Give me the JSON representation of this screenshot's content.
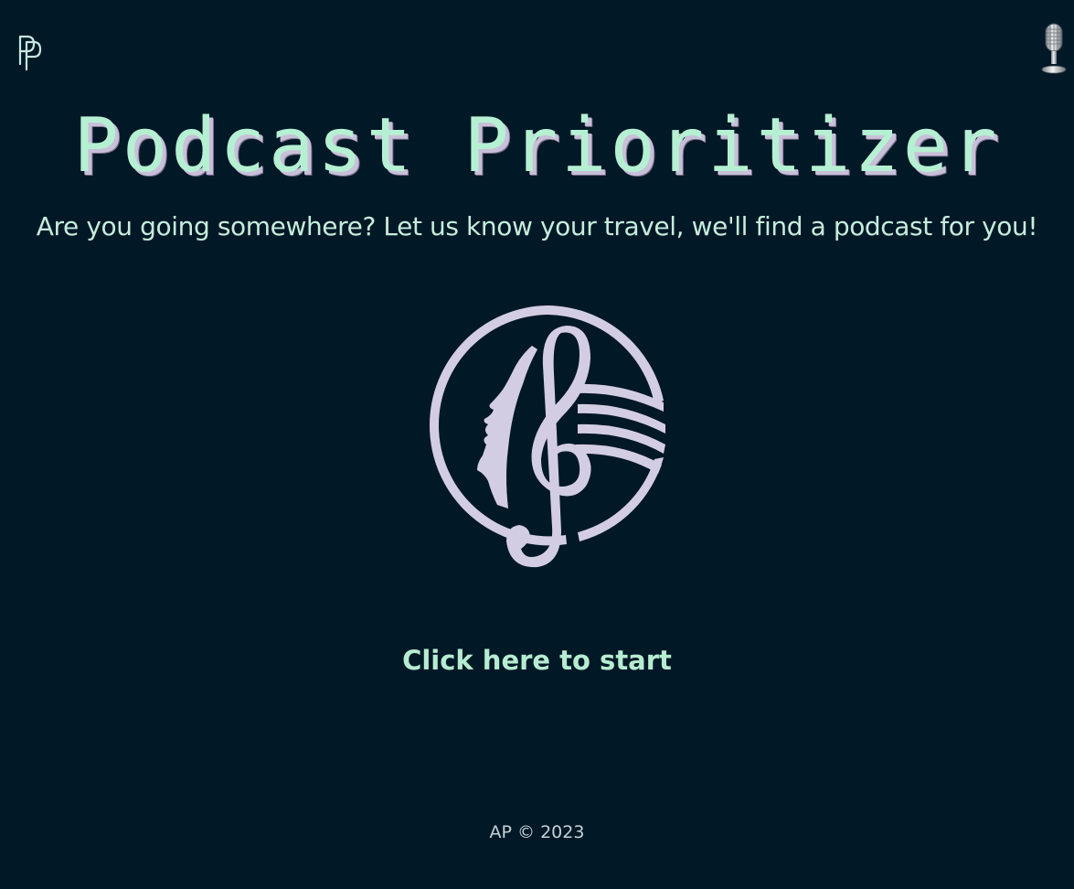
{
  "header": {
    "logo_icon": "pp-monogram-icon",
    "mic_icon": "microphone-icon"
  },
  "main": {
    "title": "Podcast Prioritizer",
    "tagline": "Are you going somewhere? Let us know your travel, we'll find a podcast for you!",
    "emblem_icon": "treble-clef-face-emblem",
    "start_label": "Click here to start"
  },
  "footer": {
    "text": "AP © 2023"
  },
  "colors": {
    "background": "#011827",
    "accent_mint": "#b6f0d2",
    "emblem_lavender": "#d3cde3"
  }
}
